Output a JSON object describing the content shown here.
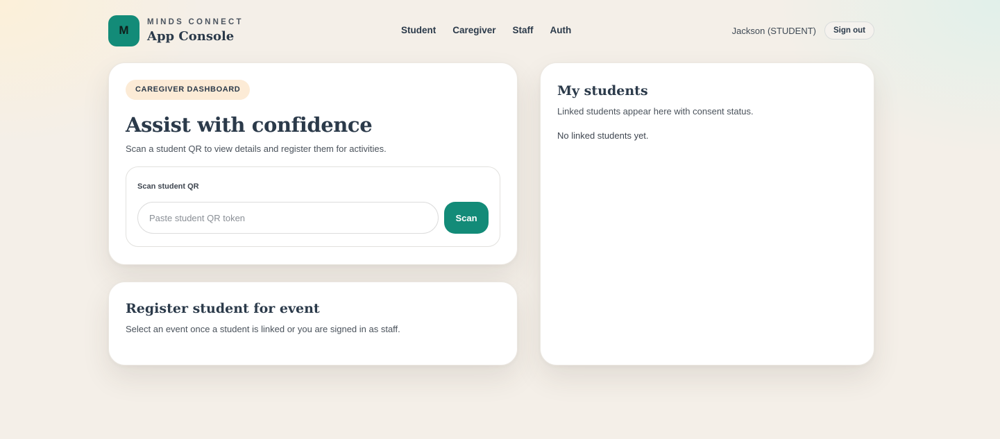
{
  "brand": {
    "logo_letter": "M",
    "kicker": "MINDS CONNECT",
    "title": "App Console"
  },
  "nav": {
    "items": [
      {
        "label": "Student"
      },
      {
        "label": "Caregiver"
      },
      {
        "label": "Staff"
      },
      {
        "label": "Auth"
      }
    ]
  },
  "user": {
    "label": "Jackson (STUDENT)",
    "signout_label": "Sign out"
  },
  "caregiver": {
    "badge": "CAREGIVER DASHBOARD",
    "title": "Assist with confidence",
    "subtitle": "Scan a student QR to view details and register them for activities.",
    "scan": {
      "label": "Scan student QR",
      "input_value": "",
      "placeholder": "Paste student QR token",
      "button_label": "Scan"
    }
  },
  "register": {
    "title": "Register student for event",
    "subtitle": "Select an event once a student is linked or you are signed in as staff."
  },
  "students": {
    "title": "My students",
    "subtitle": "Linked students appear here with consent status.",
    "empty": "No linked students yet."
  },
  "colors": {
    "accent": "#138b78",
    "badge_bg": "#fcebd6",
    "text_dark": "#2b3a4a"
  }
}
